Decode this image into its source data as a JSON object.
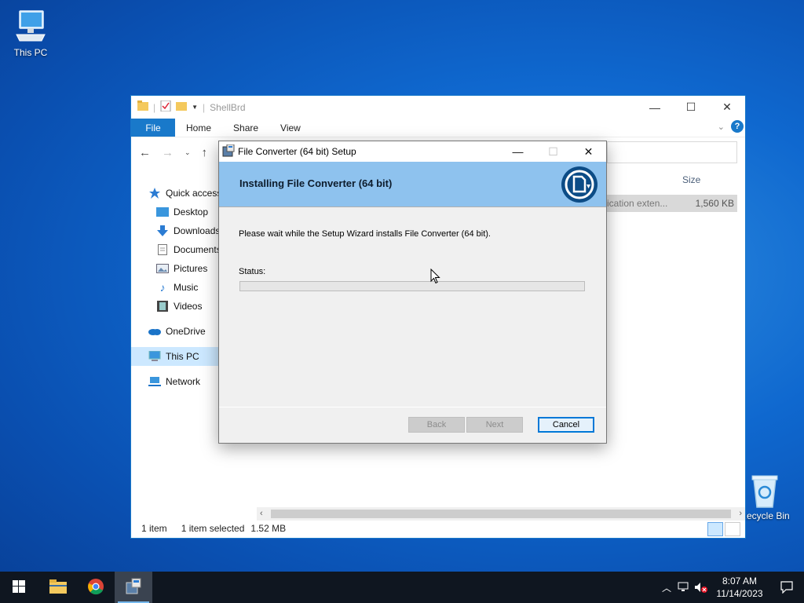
{
  "desktop": {
    "this_pc_label": "This PC",
    "recycle_bin_label": "Recycle Bin"
  },
  "explorer": {
    "title": "ShellBrd",
    "ribbon_tabs": [
      "File",
      "Home",
      "Share",
      "View"
    ],
    "nav": {
      "quick_access": "Quick access",
      "items": [
        "Desktop",
        "Downloads",
        "Documents",
        "Pictures",
        "Music",
        "Videos"
      ],
      "onedrive": "OneDrive",
      "this_pc": "This PC",
      "network": "Network"
    },
    "column_size": "Size",
    "row": {
      "type": "ication exten...",
      "size": "1,560 KB"
    },
    "status": {
      "items": "1 item",
      "selected": "1 item selected",
      "size": "1.52 MB"
    }
  },
  "setup": {
    "window_title": "File Converter (64 bit) Setup",
    "heading": "Installing File Converter (64 bit)",
    "message": "Please wait while the Setup Wizard installs File Converter (64 bit).",
    "status_label": "Status:",
    "progress": 0,
    "buttons": {
      "back": "Back",
      "next": "Next",
      "cancel": "Cancel"
    }
  },
  "taskbar": {
    "time": "8:07 AM",
    "date": "11/14/2023"
  },
  "colors": {
    "accent": "#1979ca",
    "banner": "#8ec2ee",
    "taskbar": "#0f1620"
  }
}
